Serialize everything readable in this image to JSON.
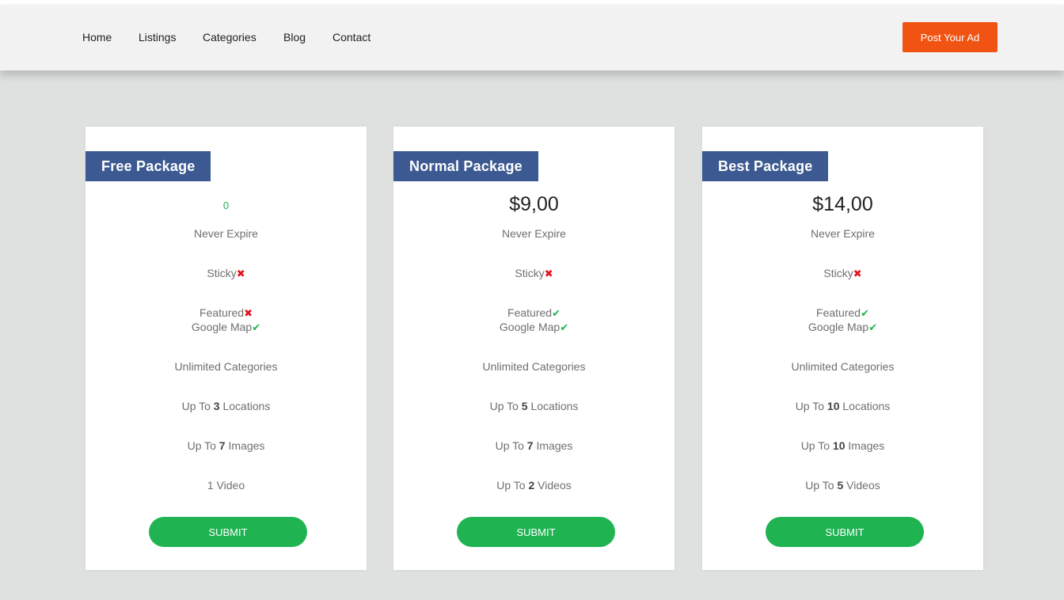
{
  "nav": {
    "links": [
      "Home",
      "Listings",
      "Categories",
      "Blog",
      "Contact"
    ],
    "post_button": "Post Your Ad"
  },
  "colors": {
    "accent_orange": "#f05312",
    "card_title_bg": "#3c5a91",
    "submit_green": "#1fb352",
    "cross_red": "#e3141b"
  },
  "packages": [
    {
      "title": "Free Package",
      "price": "0",
      "expiry": "Never Expire",
      "sticky": {
        "label": "Sticky",
        "mark": "✖"
      },
      "featured": {
        "label": "Featured",
        "mark": "✖"
      },
      "google_map": {
        "label": "Google Map",
        "mark": "✔"
      },
      "categories": "Unlimited Categories",
      "locations": {
        "prefix": "Up To ",
        "count": "3",
        "suffix": " Locations"
      },
      "images": {
        "prefix": "Up To ",
        "count": "7",
        "suffix": " Images"
      },
      "videos": {
        "prefix": "",
        "count": "1 Video",
        "suffix": ""
      },
      "submit": "SUBMIT"
    },
    {
      "title": "Normal Package",
      "price": "$9,00",
      "expiry": "Never Expire",
      "sticky": {
        "label": "Sticky",
        "mark": "✖"
      },
      "featured": {
        "label": "Featured",
        "mark": "✔"
      },
      "google_map": {
        "label": "Google Map",
        "mark": "✔"
      },
      "categories": "Unlimited Categories",
      "locations": {
        "prefix": "Up To ",
        "count": "5",
        "suffix": " Locations"
      },
      "images": {
        "prefix": "Up To ",
        "count": "7",
        "suffix": " Images"
      },
      "videos": {
        "prefix": "Up To ",
        "count": "2",
        "suffix": " Videos"
      },
      "submit": "SUBMIT"
    },
    {
      "title": "Best Package",
      "price": "$14,00",
      "expiry": "Never Expire",
      "sticky": {
        "label": "Sticky",
        "mark": "✖"
      },
      "featured": {
        "label": "Featured",
        "mark": "✔"
      },
      "google_map": {
        "label": "Google Map",
        "mark": "✔"
      },
      "categories": "Unlimited Categories",
      "locations": {
        "prefix": "Up To ",
        "count": "10",
        "suffix": " Locations"
      },
      "images": {
        "prefix": "Up To ",
        "count": "10",
        "suffix": " Images"
      },
      "videos": {
        "prefix": "Up To ",
        "count": "5",
        "suffix": " Videos"
      },
      "submit": "SUBMIT"
    }
  ]
}
